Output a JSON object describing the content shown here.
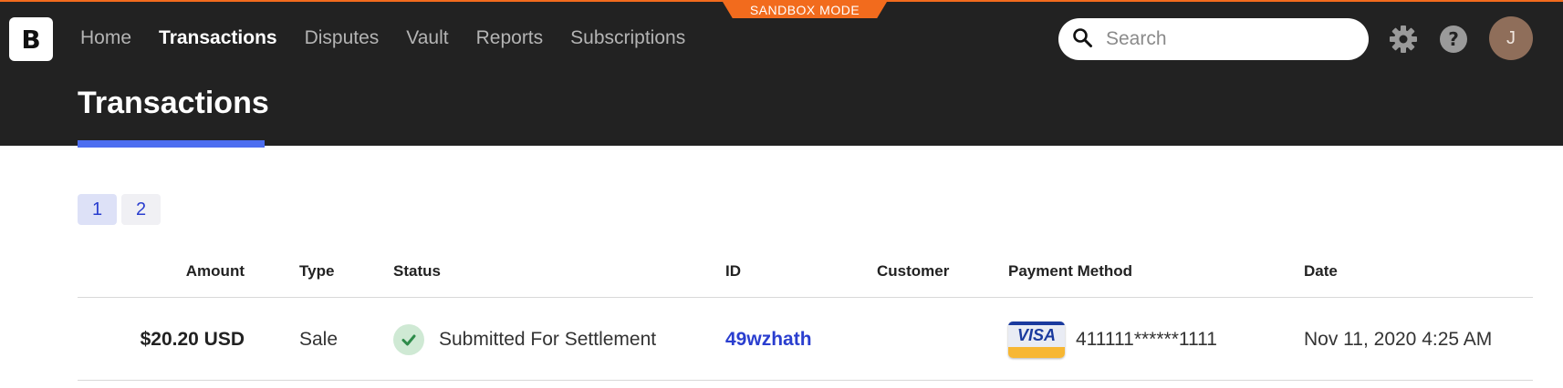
{
  "banner": {
    "sandbox_label": "SANDBOX MODE"
  },
  "logo": {
    "letter": "B"
  },
  "nav": {
    "items": [
      {
        "label": "Home",
        "active": false
      },
      {
        "label": "Transactions",
        "active": true
      },
      {
        "label": "Disputes",
        "active": false
      },
      {
        "label": "Vault",
        "active": false
      },
      {
        "label": "Reports",
        "active": false
      },
      {
        "label": "Subscriptions",
        "active": false
      }
    ]
  },
  "search": {
    "placeholder": "Search",
    "value": ""
  },
  "user": {
    "avatar_initial": "J",
    "avatar_color": "#8f6e5a"
  },
  "page": {
    "title": "Transactions"
  },
  "pagination": {
    "pages": [
      "1",
      "2"
    ],
    "current": "1"
  },
  "table": {
    "columns": {
      "amount": "Amount",
      "type": "Type",
      "status": "Status",
      "id": "ID",
      "customer": "Customer",
      "payment_method": "Payment Method",
      "date": "Date"
    },
    "rows": [
      {
        "amount": "$20.20 USD",
        "type": "Sale",
        "status": "Submitted For Settlement",
        "id": "49wzhath",
        "customer": "",
        "card_brand": "VISA",
        "card_number": "411111******1111",
        "date": "Nov 11, 2020 4:25 AM"
      }
    ]
  },
  "colors": {
    "header_bg": "#222222",
    "sandbox_orange": "#f26b1d",
    "accent_blue": "#4d6ef0",
    "link_blue": "#2a3ecf",
    "success_green": "#2e8b4a"
  }
}
